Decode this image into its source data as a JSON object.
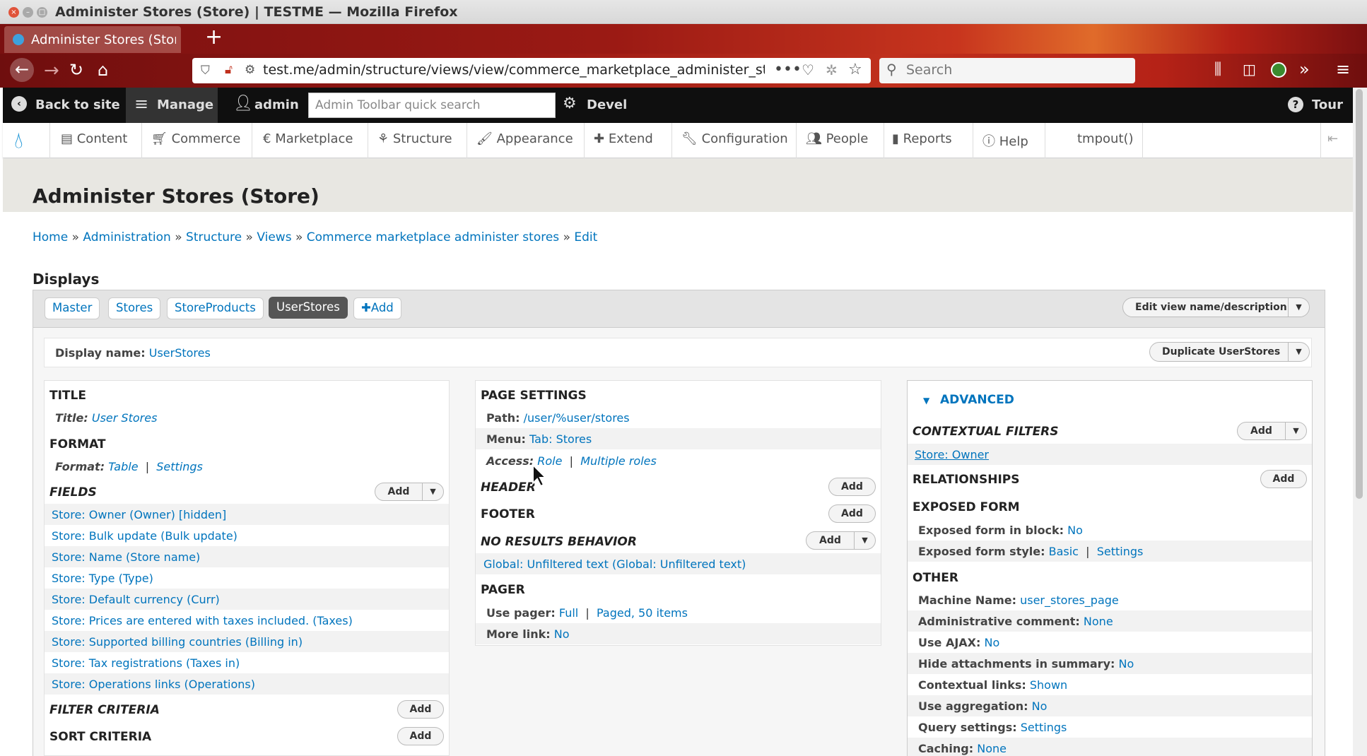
{
  "window": {
    "title": "Administer Stores (Store) | TESTME — Mozilla Firefox"
  },
  "browser": {
    "tab_title": "Administer Stores (Store) | TESTME",
    "url": "test.me/admin/structure/views/view/commerce_marketplace_administer_stores/edit/user_stores_page",
    "search_placeholder": "Search"
  },
  "admin_toolbar": {
    "back_to_site": "Back to site",
    "manage": "Manage",
    "user": "admin",
    "search_placeholder": "Admin Toolbar quick search",
    "devel": "Devel",
    "tour": "Tour"
  },
  "menu": {
    "items": [
      "Content",
      "Commerce",
      "Marketplace",
      "Structure",
      "Appearance",
      "Extend",
      "Configuration",
      "People",
      "Reports",
      "Help",
      "tmpout()"
    ]
  },
  "page": {
    "title": "Administer Stores (Store)",
    "breadcrumb": [
      "Home",
      "Administration",
      "Structure",
      "Views",
      "Commerce marketplace administer stores",
      "Edit"
    ],
    "breadcrumb_sep": "»",
    "displays_heading": "Displays"
  },
  "displays": {
    "tabs": [
      "Master",
      "Stores",
      "StoreProducts",
      "UserStores"
    ],
    "add": "Add",
    "edit_view_button": "Edit view name/description",
    "display_name_label": "Display name:",
    "display_name_value": "UserStores",
    "duplicate_button": "Duplicate UserStores"
  },
  "col1": {
    "title_head": "TITLE",
    "title_label": "Title:",
    "title_value": "User Stores",
    "format_head": "FORMAT",
    "format_label": "Format:",
    "format_value": "Table",
    "format_settings": "Settings",
    "fields_head": "FIELDS",
    "fields": [
      "Store: Owner (Owner) [hidden]",
      "Store: Bulk update (Bulk update)",
      "Store: Name (Store name)",
      "Store: Type (Type)",
      "Store: Default currency (Curr)",
      "Store: Prices are entered with taxes included. (Taxes)",
      "Store: Supported billing countries (Billing in)",
      "Store: Tax registrations (Taxes in)",
      "Store: Operations links (Operations)"
    ],
    "filter_head": "FILTER CRITERIA",
    "sort_head": "SORT CRITERIA",
    "add": "Add"
  },
  "col2": {
    "page_settings_head": "PAGE SETTINGS",
    "path_label": "Path:",
    "path_value": "/user/%user/stores",
    "menu_label": "Menu:",
    "menu_value": "Tab: Stores",
    "access_label": "Access:",
    "access_value": "Role",
    "access_value2": "Multiple roles",
    "header_head": "HEADER",
    "footer_head": "FOOTER",
    "no_results_head": "NO RESULTS BEHAVIOR",
    "no_results_item": "Global: Unfiltered text (Global: Unfiltered text)",
    "pager_head": "PAGER",
    "use_pager_label": "Use pager:",
    "use_pager_value": "Full",
    "use_pager_value2": "Paged, 50 items",
    "more_link_label": "More link:",
    "more_link_value": "No",
    "add": "Add"
  },
  "col3": {
    "advanced_head": "ADVANCED",
    "contextual_head": "CONTEXTUAL FILTERS",
    "contextual_item": "Store: Owner",
    "relationships_head": "RELATIONSHIPS",
    "exposed_head": "EXPOSED FORM",
    "exposed_block_label": "Exposed form in block:",
    "exposed_block_value": "No",
    "exposed_style_label": "Exposed form style:",
    "exposed_style_value": "Basic",
    "exposed_style_settings": "Settings",
    "other_head": "OTHER",
    "other_rows": [
      {
        "label": "Machine Name:",
        "value": "user_stores_page"
      },
      {
        "label": "Administrative comment:",
        "value": "None"
      },
      {
        "label": "Use AJAX:",
        "value": "No"
      },
      {
        "label": "Hide attachments in summary:",
        "value": "No"
      },
      {
        "label": "Contextual links:",
        "value": "Shown"
      },
      {
        "label": "Use aggregation:",
        "value": "No"
      },
      {
        "label": "Query settings:",
        "value": "Settings"
      },
      {
        "label": "Caching:",
        "value": "None"
      }
    ],
    "add": "Add"
  }
}
